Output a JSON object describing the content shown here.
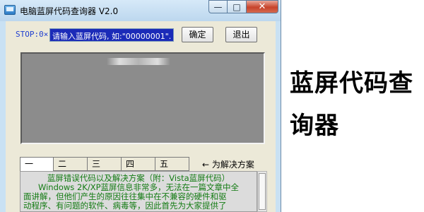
{
  "window": {
    "title": "电脑蓝屏代码查询器 V2.0",
    "controls": {
      "minimize": "—",
      "maximize": "□",
      "close": "✕"
    },
    "icon": "app-window-icon"
  },
  "toolbar": {
    "stop_label": "STOP:0×",
    "code_input_value": "请输入蓝屏代码, 如:\"00000001\".",
    "ok_button": "确定",
    "exit_button": "退出"
  },
  "tabs": [
    "一",
    "二",
    "三",
    "四",
    "五"
  ],
  "tab_hint": "← 为解决方案",
  "info_panel": {
    "lines": [
      "蓝屏错误代码以及解决方案（附：Vista蓝屏代码）",
      "Windows 2K/XP蓝屏信息非常多，无法在一篇文章中全",
      "面讲解，但他们产生的原因往往集中在不兼容的硬件和驱",
      "动程序、有问题的软件、病毒等，因此首先为大家提供了"
    ],
    "text_color": "#137b13"
  },
  "headline": {
    "line1": "蓝屏代码查",
    "line2": "询器"
  },
  "colors": {
    "window_frame": "#c9e1f3",
    "input_bg": "#1b2bb8",
    "stop_label": "#1f3fd0"
  }
}
